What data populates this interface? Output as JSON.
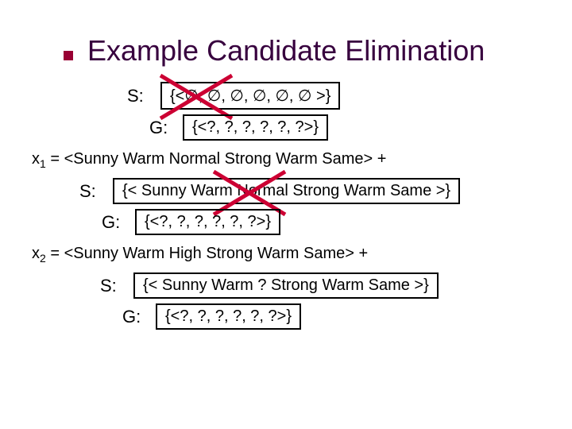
{
  "title": "Example Candidate Elimination",
  "step1": {
    "s_label": "S:",
    "s_box": "{<∅, ∅, ∅, ∅, ∅, ∅ >}",
    "g_label": "G:",
    "g_box": "{<?, ?, ?, ?, ?, ?>}"
  },
  "ex1": "x₁ = <Sunny Warm Normal Strong Warm Same> +",
  "step2": {
    "s_label": "S:",
    "s_box": "{< Sunny Warm Normal Strong Warm Same >}",
    "g_label": "G:",
    "g_box": "{<?, ?, ?, ?, ?, ?>}"
  },
  "ex2": "x₂ = <Sunny Warm High Strong Warm Same> +",
  "step3": {
    "s_label": "S:",
    "s_box": "{< Sunny Warm ? Strong Warm Same >}",
    "g_label": "G:",
    "g_box": "{<?, ?, ?, ?, ?, ?>}"
  }
}
